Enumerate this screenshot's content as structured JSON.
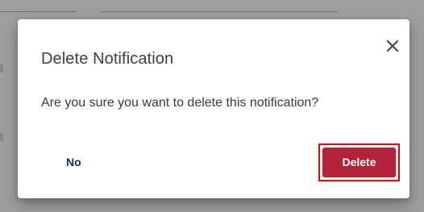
{
  "dialog": {
    "title": "Delete Notification",
    "message": "Are you sure you want to delete this notification?",
    "close_icon": "close-icon",
    "no_label": "No",
    "delete_label": "Delete"
  },
  "colors": {
    "delete_button": "#b4213a",
    "highlight_border": "#f00000",
    "no_text": "#1f2d45",
    "scrim": "#9e9e9e"
  }
}
